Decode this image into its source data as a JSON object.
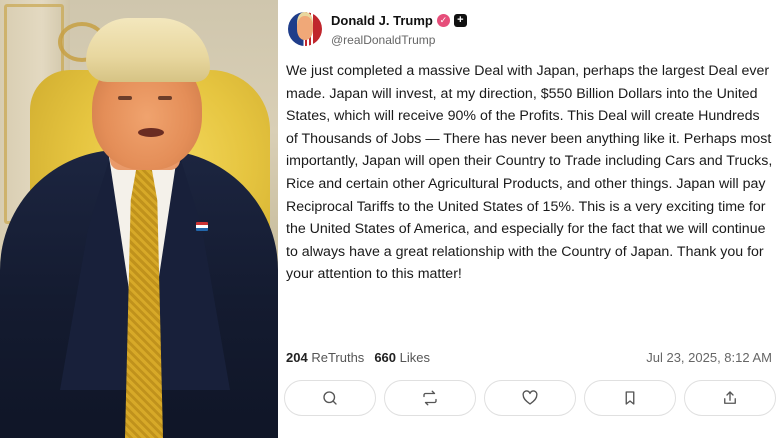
{
  "post": {
    "author_name": "Donald J. Trump",
    "author_handle": "@realDonaldTrump",
    "text": "We just completed a massive Deal with Japan, perhaps the largest Deal ever made. Japan will invest, at my direction, $550 Billion Dollars into the United States, which will receive 90% of the Profits. This Deal will create Hundreds of Thousands of Jobs — There has never been anything like it. Perhaps most importantly, Japan will open their Country to Trade including Cars and Trucks, Rice and certain other Agricultural Products, and other things. Japan will pay Reciprocal Tariffs to the United States of 15%. This is a very exciting time for the United States of America, and especially for the fact that we will continue to always have a great relationship with the Country of Japan. Thank you for your attention to this matter!",
    "retruths_count": "204",
    "retruths_label": "ReTruths",
    "likes_count": "660",
    "likes_label": "Likes",
    "timestamp": "Jul 23, 2025, 8:12 AM",
    "verified_badge_icon": "verified-badge-icon",
    "plus_badge_icon": "plus-badge-icon"
  },
  "actions": [
    {
      "icon": "reply-icon"
    },
    {
      "icon": "retruth-icon"
    },
    {
      "icon": "like-icon"
    },
    {
      "icon": "bookmark-icon"
    },
    {
      "icon": "share-icon"
    }
  ],
  "colors": {
    "badge": "#e64e7a",
    "text": "#1a1a1a",
    "muted": "#666666"
  }
}
